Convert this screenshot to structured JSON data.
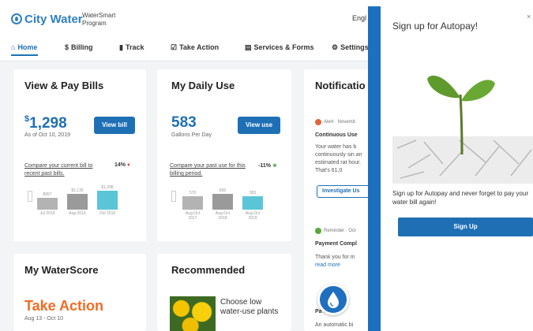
{
  "header": {
    "brand": "City Water",
    "program": "WaterSmart Program",
    "lang": "Engl"
  },
  "nav": {
    "items": [
      {
        "label": "Home",
        "icon": "home-icon"
      },
      {
        "label": "Billing",
        "icon": "dollar-icon"
      },
      {
        "label": "Track",
        "icon": "bar-chart-icon"
      },
      {
        "label": "Take Action",
        "icon": "checklist-icon"
      },
      {
        "label": "Services & Forms",
        "icon": "document-icon"
      },
      {
        "label": "Settings",
        "icon": "gear-icon"
      }
    ]
  },
  "bills": {
    "title": "View & Pay Bills",
    "amount": "1,298",
    "currency": "$",
    "as_of": "As of Oct 10, 2019",
    "button": "View bill",
    "compare": "Compare your current bill to recent past bills.",
    "delta": "14%",
    "bars": [
      {
        "value": "$957",
        "label": "Jul 2019",
        "fraction": 0.55,
        "color": "#b3b3b3"
      },
      {
        "value": "$1,135",
        "label": "Aug 2019",
        "fraction": 0.7,
        "color": "#9a9a9a"
      },
      {
        "value": "$1,298",
        "label": "Oct 2019",
        "fraction": 0.85,
        "color": "#5bc5d8"
      }
    ]
  },
  "daily": {
    "title": "My Daily Use",
    "amount": "583",
    "unit": "Gallons Per Day",
    "button": "View use",
    "compare": "Compare your past use for this billing period.",
    "delta": "-11%",
    "bars": [
      {
        "value": "570",
        "label": "Aug-Oct 2017",
        "fraction": 0.6,
        "color": "#b3b3b3"
      },
      {
        "value": "655",
        "label": "Aug-Oct 2018",
        "fraction": 0.7,
        "color": "#9a9a9a"
      },
      {
        "value": "583",
        "label": "Aug-Oct 2019",
        "fraction": 0.62,
        "color": "#5bc5d8"
      }
    ]
  },
  "notifications": {
    "title": "Notificatio",
    "alert_tag": "Alert · Novemb",
    "alert_head": "Continuous Use",
    "alert_body": "Your water has b continuously sin an estimated rat hour. That's 61,0",
    "alert_button": "Investigate Us",
    "reminder_tag": "Reminder · Oct",
    "reminder_head": "Payment Compl",
    "reminder_body": "Thank you for m",
    "read_more": "read more",
    "third_head": "Pa       che",
    "third_body": "An automatic bi"
  },
  "waterscore": {
    "title": "My WaterScore",
    "status": "Take Action",
    "dates": "Aug 13 - Oct 10"
  },
  "recommended": {
    "title": "Recommended",
    "item": "Choose low water-use plants"
  },
  "autopay": {
    "title": "Sign up for Autopay!",
    "text": "Sign up for Autopay and never forget to pay your water bill again!",
    "button": "Sign Up"
  },
  "colors": {
    "accent": "#1f6fb5",
    "take_action": "#f36b21",
    "bar_current": "#5bc5d8"
  }
}
